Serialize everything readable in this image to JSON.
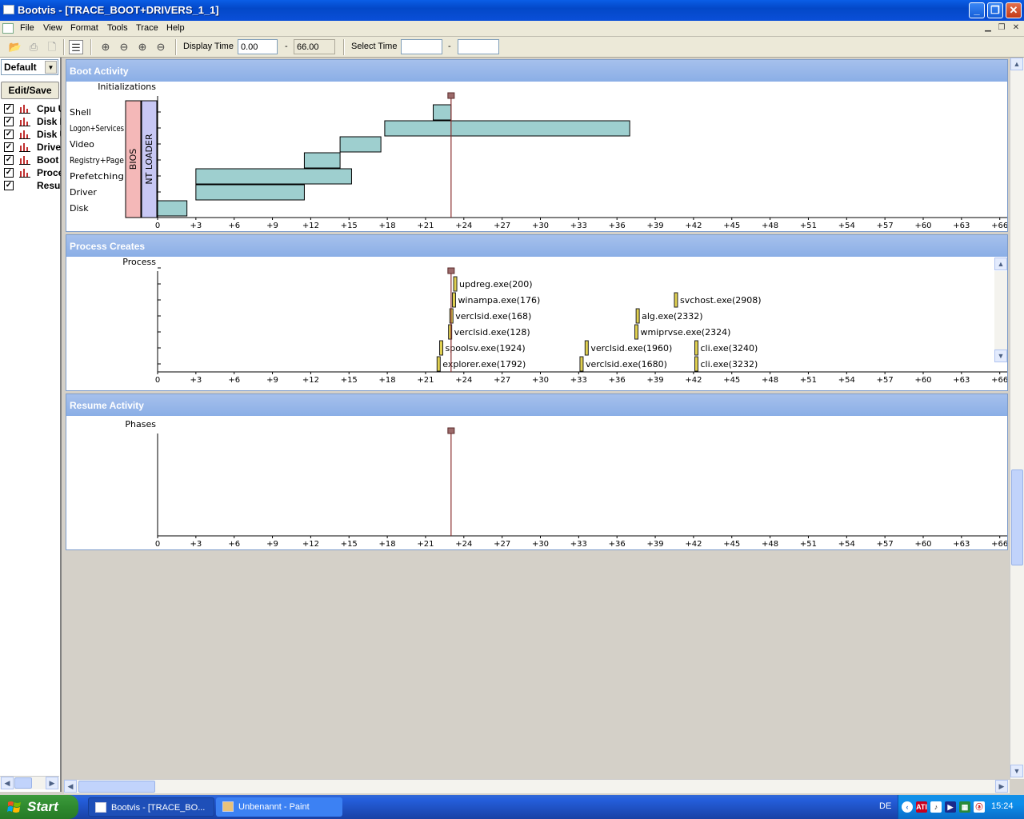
{
  "window": {
    "title": "Bootvis - [TRACE_BOOT+DRIVERS_1_1]"
  },
  "menu": [
    "File",
    "View",
    "Format",
    "Tools",
    "Trace",
    "Help"
  ],
  "toolbar": {
    "display_time_label": "Display Time",
    "display_time_from": "0.00",
    "display_time_to": "66.00",
    "select_time_label": "Select Time",
    "select_time_from": "",
    "select_time_to": "",
    "dash": "-"
  },
  "sidebar": {
    "view_select": "Default",
    "edit_button": "Edit/Save",
    "items": [
      {
        "label": "Cpu Usage",
        "checked": true,
        "icon": "bar-chart-icon"
      },
      {
        "label": "Disk I/O",
        "checked": true,
        "icon": "bar-chart-icon"
      },
      {
        "label": "Disk Utilization",
        "checked": true,
        "icon": "bar-chart-icon"
      },
      {
        "label": "Driver Delays",
        "checked": true,
        "icon": "bar-chart-icon"
      },
      {
        "label": "Boot Activity",
        "checked": true,
        "icon": "bar-chart-icon"
      },
      {
        "label": "Process Creates",
        "checked": true,
        "icon": "bar-chart-icon"
      },
      {
        "label": "Resume Activity",
        "checked": true,
        "icon": "none"
      }
    ]
  },
  "axis_ticks": [
    "0",
    "+3",
    "+6",
    "+9",
    "+12",
    "+15",
    "+18",
    "+21",
    "+24",
    "+27",
    "+30",
    "+33",
    "+36",
    "+39",
    "+42",
    "+45",
    "+48",
    "+51",
    "+54",
    "+57",
    "+60",
    "+63",
    "+66"
  ],
  "marker_time": 23.0,
  "boot_panel": {
    "title": "Boot Activity",
    "ylabel": "Initializations",
    "rows": [
      "Shell",
      "Logon+Services",
      "Video",
      "Registry+Page",
      "Prefetching",
      "Driver",
      "Disk"
    ],
    "phases": [
      "BIOS",
      "NT LOADER"
    ],
    "bars": [
      {
        "row": "Disk",
        "start": 0.0,
        "end": 2.3
      },
      {
        "row": "Driver",
        "start": 3.0,
        "end": 11.5
      },
      {
        "row": "Prefetching",
        "start": 3.0,
        "end": 15.2
      },
      {
        "row": "Registry+Page",
        "start": 11.5,
        "end": 14.3
      },
      {
        "row": "Video",
        "start": 14.3,
        "end": 17.5
      },
      {
        "row": "Logon+Services",
        "start": 17.8,
        "end": 37.0
      },
      {
        "row": "Shell",
        "start": 21.6,
        "end": 23.0
      }
    ]
  },
  "process_panel": {
    "title": "Process Creates",
    "ylabel": "Process",
    "processes": [
      {
        "name": "updreg.exe(200)",
        "time": 23.2,
        "level": 6
      },
      {
        "name": "winampa.exe(176)",
        "time": 23.1,
        "level": 5
      },
      {
        "name": "verclsid.exe(168)",
        "time": 22.9,
        "level": 4
      },
      {
        "name": "verclsid.exe(128)",
        "time": 22.8,
        "level": 3
      },
      {
        "name": "spoolsv.exe(1924)",
        "time": 22.1,
        "level": 2
      },
      {
        "name": "explorer.exe(1792)",
        "time": 21.9,
        "level": 1
      },
      {
        "name": "verclsid.exe(1960)",
        "time": 33.5,
        "level": 2
      },
      {
        "name": "verclsid.exe(1680)",
        "time": 33.1,
        "level": 1
      },
      {
        "name": "alg.exe(2332)",
        "time": 37.5,
        "level": 4
      },
      {
        "name": "wmiprvse.exe(2324)",
        "time": 37.4,
        "level": 3
      },
      {
        "name": "svchost.exe(2908)",
        "time": 40.5,
        "level": 5
      },
      {
        "name": "cli.exe(3240)",
        "time": 42.1,
        "level": 2
      },
      {
        "name": "cli.exe(3232)",
        "time": 42.1,
        "level": 1
      }
    ]
  },
  "resume_panel": {
    "title": "Resume Activity",
    "ylabel": "Phases"
  },
  "taskbar": {
    "start": "Start",
    "tasks": [
      "Bootvis - [TRACE_BO...",
      "Unbenannt - Paint"
    ],
    "language": "DE",
    "clock": "15:24"
  },
  "colors": {
    "bar_fill": "#9ecfcf",
    "bios": "#f4b8b8",
    "ntloader": "#c8c8f4",
    "process_bar": "#e0d050",
    "marker": "#8b3030"
  }
}
